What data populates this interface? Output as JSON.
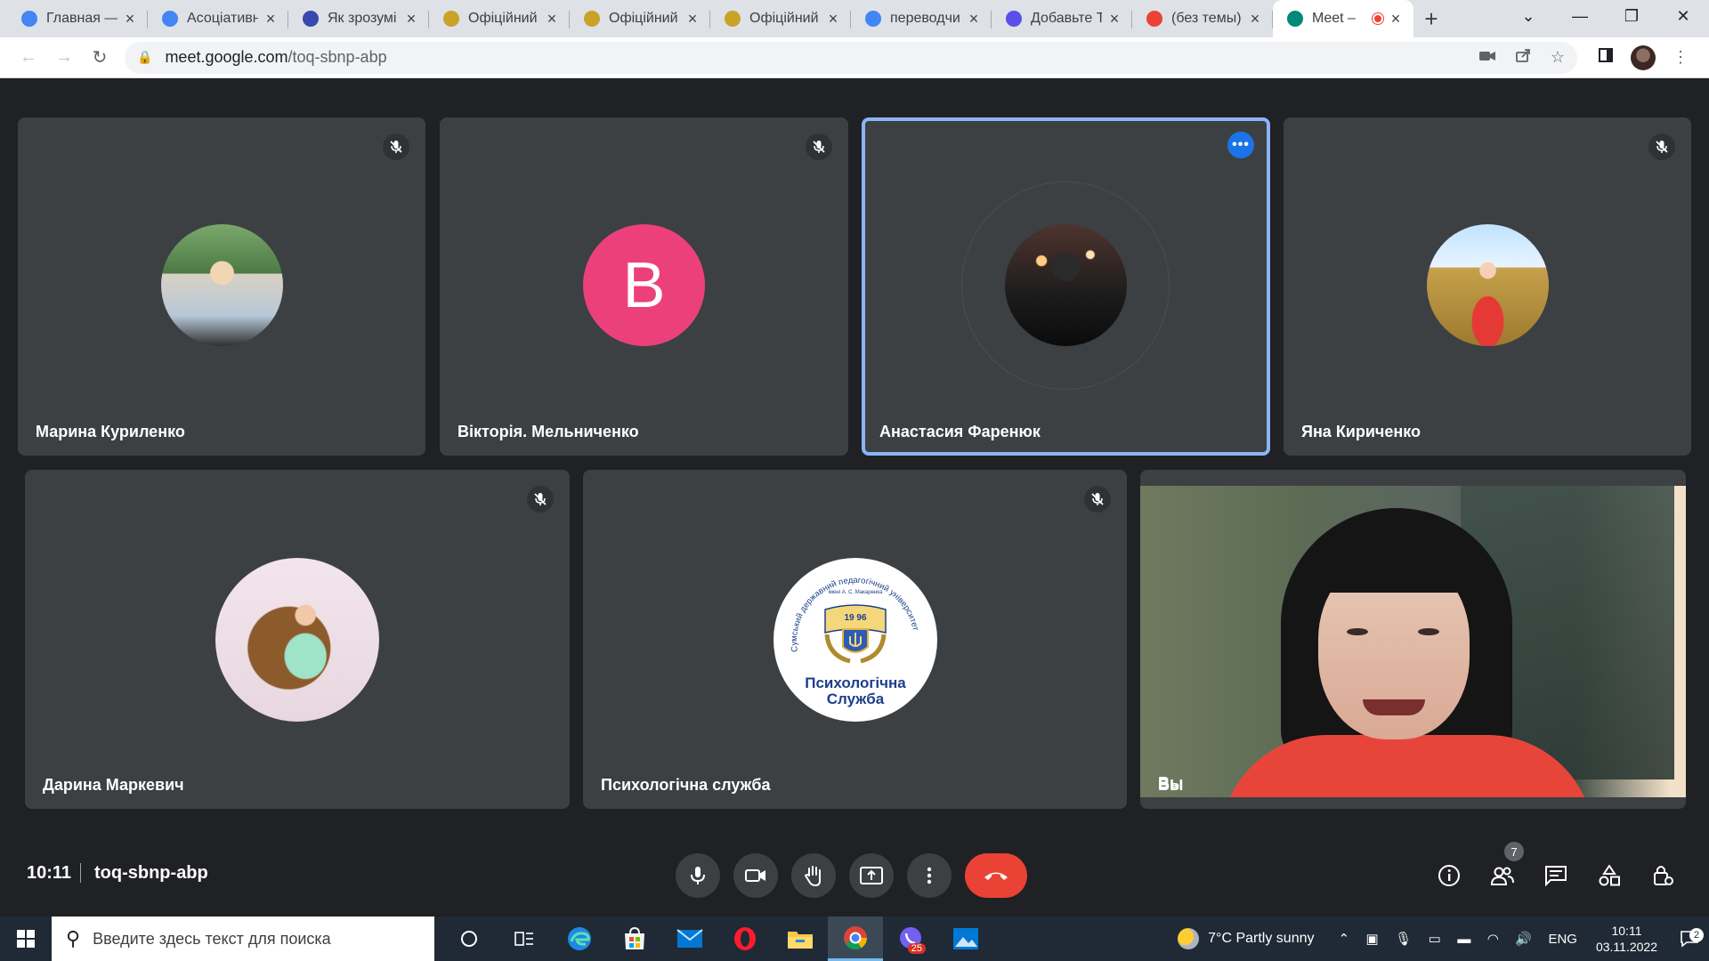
{
  "browser": {
    "tabs": [
      {
        "title": "Главная —",
        "favicon": "chrome-icon",
        "color": "#4285f4"
      },
      {
        "title": "Асоціативн",
        "favicon": "google-icon",
        "color": "#4285f4"
      },
      {
        "title": "Як зрозумі",
        "favicon": "w-site-icon",
        "color": "#3949ab"
      },
      {
        "title": "Офіційний",
        "favicon": "crest-icon",
        "color": "#c9a227"
      },
      {
        "title": "Офіційний",
        "favicon": "crest-icon",
        "color": "#c9a227"
      },
      {
        "title": "Офіційний",
        "favicon": "crest-icon",
        "color": "#c9a227"
      },
      {
        "title": "переводчи",
        "favicon": "google-icon",
        "color": "#4285f4"
      },
      {
        "title": "Добавьте Т",
        "favicon": "shield-icon",
        "color": "#5b4fe9"
      },
      {
        "title": "(без темы)",
        "favicon": "gmail-icon",
        "color": "#ea4335"
      },
      {
        "title": "Meet –",
        "favicon": "meet-icon",
        "color": "#00897b"
      }
    ],
    "active_tab_index": 9,
    "url_host": "meet.google.com",
    "url_path": "/toq-sbnp-abp"
  },
  "participants": [
    {
      "name": "Марина Куриленко",
      "muted": true
    },
    {
      "name": "Вікторія. Мельниченко",
      "muted": true,
      "initial": "В"
    },
    {
      "name": "Анастасия Фаренюк",
      "muted": false,
      "speaking": true
    },
    {
      "name": "Яна Кириченко",
      "muted": true
    },
    {
      "name": "Дарина Маркевич",
      "muted": true
    },
    {
      "name": "Психологічна служба",
      "muted": true
    },
    {
      "name": "Вы",
      "muted": false,
      "self": true
    }
  ],
  "logo": {
    "arc_text": "Сумський державний педагогічний університет",
    "sub_text": "імені А. С. Макаренка",
    "year": "19 96",
    "line1": "Психологічна",
    "line2": "Служба"
  },
  "meeting": {
    "time": "10:11",
    "code": "toq-sbnp-abp",
    "participant_count": "7"
  },
  "taskbar": {
    "search_placeholder": "Введите здесь текст для поиска",
    "weather": "7°C  Partly sunny",
    "lang": "ENG",
    "time": "10:11",
    "date": "03.11.2022",
    "viber_badge": "25",
    "notif_count": "2"
  },
  "colors": {
    "meet_bg": "#202124",
    "tile_bg": "#3c4043",
    "hangup": "#ea4335",
    "speaking_outline": "#8ab4f8",
    "letter_avatar": "#ec407a"
  }
}
